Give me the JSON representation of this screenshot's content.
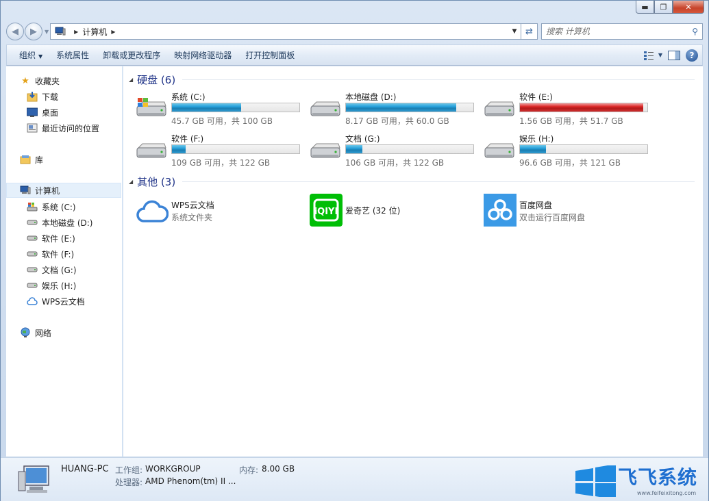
{
  "address": {
    "crumbs": [
      "计算机"
    ],
    "search_placeholder": "搜索 计算机"
  },
  "toolbar": {
    "organize": "组织",
    "system_properties": "系统属性",
    "uninstall": "卸载或更改程序",
    "map_drive": "映射网络驱动器",
    "control_panel": "打开控制面板"
  },
  "nav": {
    "favorites": "收藏夹",
    "downloads": "下载",
    "desktop": "桌面",
    "recent": "最近访问的位置",
    "libraries": "库",
    "computer": "计算机",
    "drives": [
      "系统 (C:)",
      "本地磁盘 (D:)",
      "软件 (E:)",
      "软件 (F:)",
      "文档 (G:)",
      "娱乐 (H:)"
    ],
    "wps": "WPS云文档",
    "network": "网络"
  },
  "groups": {
    "hard_disks": "硬盘 (6)",
    "other": "其他 (3)"
  },
  "drives": [
    {
      "name": "系统 (C:)",
      "info": "45.7 GB 可用，共 100 GB",
      "used_fraction": 0.543,
      "warning": false
    },
    {
      "name": "本地磁盘 (D:)",
      "info": "8.17 GB 可用，共 60.0 GB",
      "used_fraction": 0.864,
      "warning": false
    },
    {
      "name": "软件 (E:)",
      "info": "1.56 GB 可用，共 51.7 GB",
      "used_fraction": 0.97,
      "warning": true
    },
    {
      "name": "软件 (F:)",
      "info": "109 GB 可用，共 122 GB",
      "used_fraction": 0.107,
      "warning": false
    },
    {
      "name": "文档 (G:)",
      "info": "106 GB 可用，共 122 GB",
      "used_fraction": 0.131,
      "warning": false
    },
    {
      "name": "娱乐 (H:)",
      "info": "96.6 GB 可用，共 121 GB",
      "used_fraction": 0.202,
      "warning": false
    }
  ],
  "others": [
    {
      "name": "WPS云文档",
      "desc": "系统文件夹"
    },
    {
      "name": "爱奇艺 (32 位)",
      "desc": ""
    },
    {
      "name": "百度网盘",
      "desc": "双击运行百度网盘"
    }
  ],
  "details": {
    "pc_name": "HUANG-PC",
    "workgroup_label": "工作组:",
    "workgroup_value": "WORKGROUP",
    "memory_label": "内存:",
    "memory_value": "8.00 GB",
    "cpu_label": "处理器:",
    "cpu_value": "AMD Phenom(tm) II ..."
  },
  "watermark": {
    "text": "飞飞系统",
    "url": "www.feifeixitong.com"
  },
  "colors": {
    "bar_normal": "#26a0da",
    "bar_warning": "#da2626",
    "group_title": "#1e3287"
  }
}
